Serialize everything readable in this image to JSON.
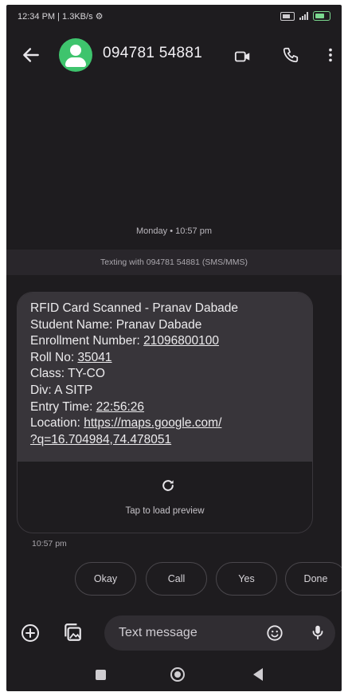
{
  "status_bar": {
    "time_speed": "12:34 PM | 1.3KB/s ⚙"
  },
  "header": {
    "contact": "094781 54881"
  },
  "conversation": {
    "date_separator": "Monday • 10:57 pm",
    "texting_info": "Texting with 094781 54881 (SMS/MMS)",
    "message": {
      "line1": "RFID Card Scanned - Pranav Dabade",
      "line2": "Student Name: Pranav Dabade",
      "enrollment_label": "Enrollment Number: ",
      "enrollment_value": "21096800100",
      "roll_label": "Roll No: ",
      "roll_value": "35041",
      "class_line": "Class: TY-CO",
      "div_line": "Div: A SITP",
      "entry_label": "Entry Time: ",
      "entry_value": "22:56:26",
      "location_label": "Location: ",
      "location_link_1": "https://maps.google.com/",
      "location_link_2": "?q=16.704984,74.478051"
    },
    "preview_text": "Tap to load preview",
    "timestamp": "10:57 pm"
  },
  "smart_replies": [
    "Okay",
    "Call",
    "Yes",
    "Done"
  ],
  "composer": {
    "placeholder": "Text message"
  },
  "colors": {
    "background": "#1e1c1f",
    "bubble": "#38353a",
    "avatar": "#3ec46d"
  }
}
